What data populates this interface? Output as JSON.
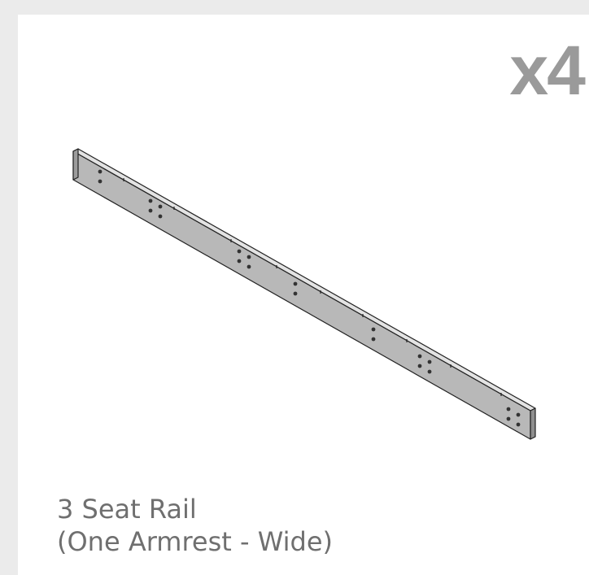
{
  "card": {
    "quantity": "x4",
    "part_name_line1": "3 Seat Rail",
    "part_name_line2": "(One Armrest - Wide)"
  },
  "colors": {
    "page_background": "#ebebeb",
    "card_background": "#ffffff",
    "quantity_text": "#9a9a9a",
    "label_text": "#6f6f6f",
    "rail_face": "#b8b8b8",
    "rail_top": "#e3e3e3",
    "outline": "#222222"
  },
  "illustration": {
    "subject": "seat-rail",
    "view": "isometric"
  }
}
